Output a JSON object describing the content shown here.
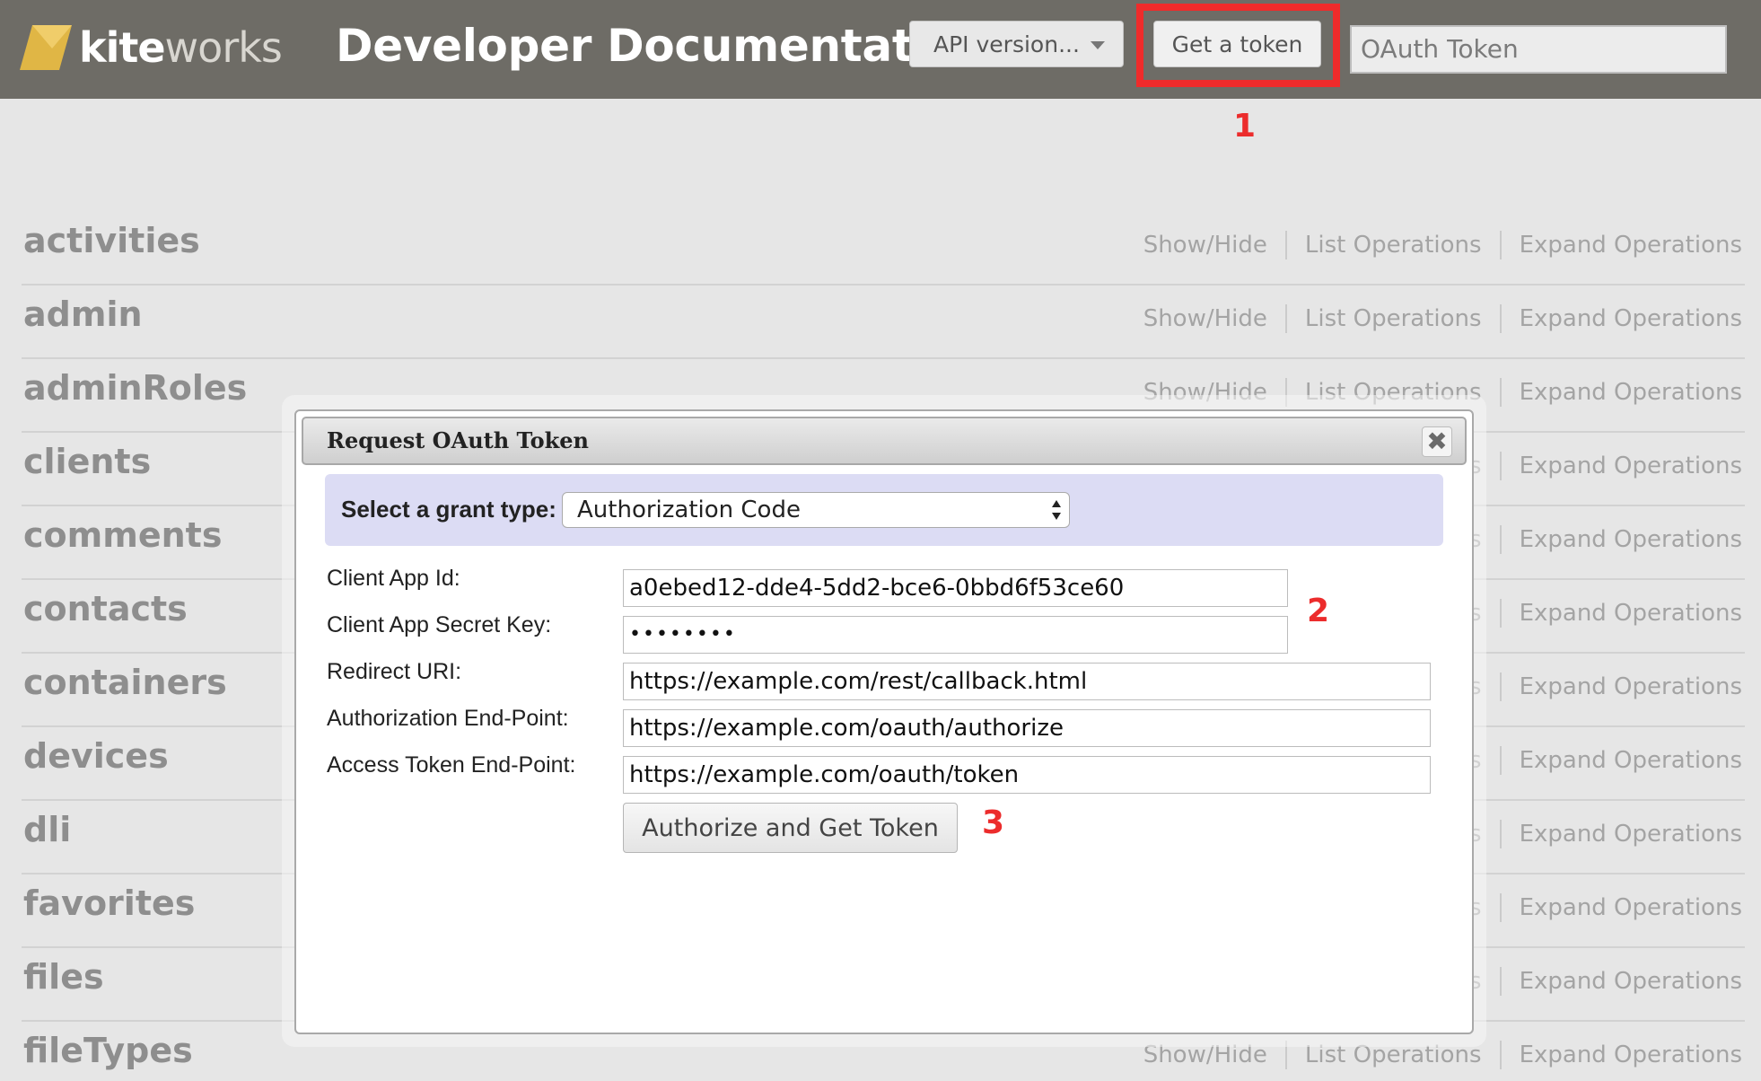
{
  "header": {
    "logo": {
      "bold": "kite",
      "light": "works"
    },
    "title": "Developer Documentation",
    "api_version_label": "API version...",
    "get_token_label": "Get a token",
    "token_placeholder": "OAuth Token"
  },
  "annotations": {
    "step1": "1",
    "step2": "2",
    "step3": "3",
    "highlight_color": "#ef2b2b"
  },
  "operations": {
    "show_hide": "Show/Hide",
    "list": "List Operations",
    "expand": "Expand Operations"
  },
  "resources": [
    "activities",
    "admin",
    "adminRoles",
    "clients",
    "comments",
    "contacts",
    "containers",
    "devices",
    "dli",
    "favorites",
    "files",
    "fileTypes"
  ],
  "modal": {
    "title": "Request OAuth Token",
    "close_glyph": "✖",
    "grant_label": "Select a grant type:",
    "grant_value": "Authorization Code",
    "fields": {
      "client_id": {
        "label": "Client App Id:",
        "value": "a0ebed12-dde4-5dd2-bce6-0bbd6f53ce60"
      },
      "secret": {
        "label": "Client App Secret Key:",
        "value": "••••••••"
      },
      "redirect": {
        "label": "Redirect URI:",
        "value": "https://example.com/rest/callback.html"
      },
      "auth_endpoint": {
        "label": "Authorization End-Point:",
        "value": "https://example.com/oauth/authorize"
      },
      "token_endpoint": {
        "label": "Access Token End-Point:",
        "value": "https://example.com/oauth/token"
      }
    },
    "submit_label": "Authorize and Get Token"
  }
}
